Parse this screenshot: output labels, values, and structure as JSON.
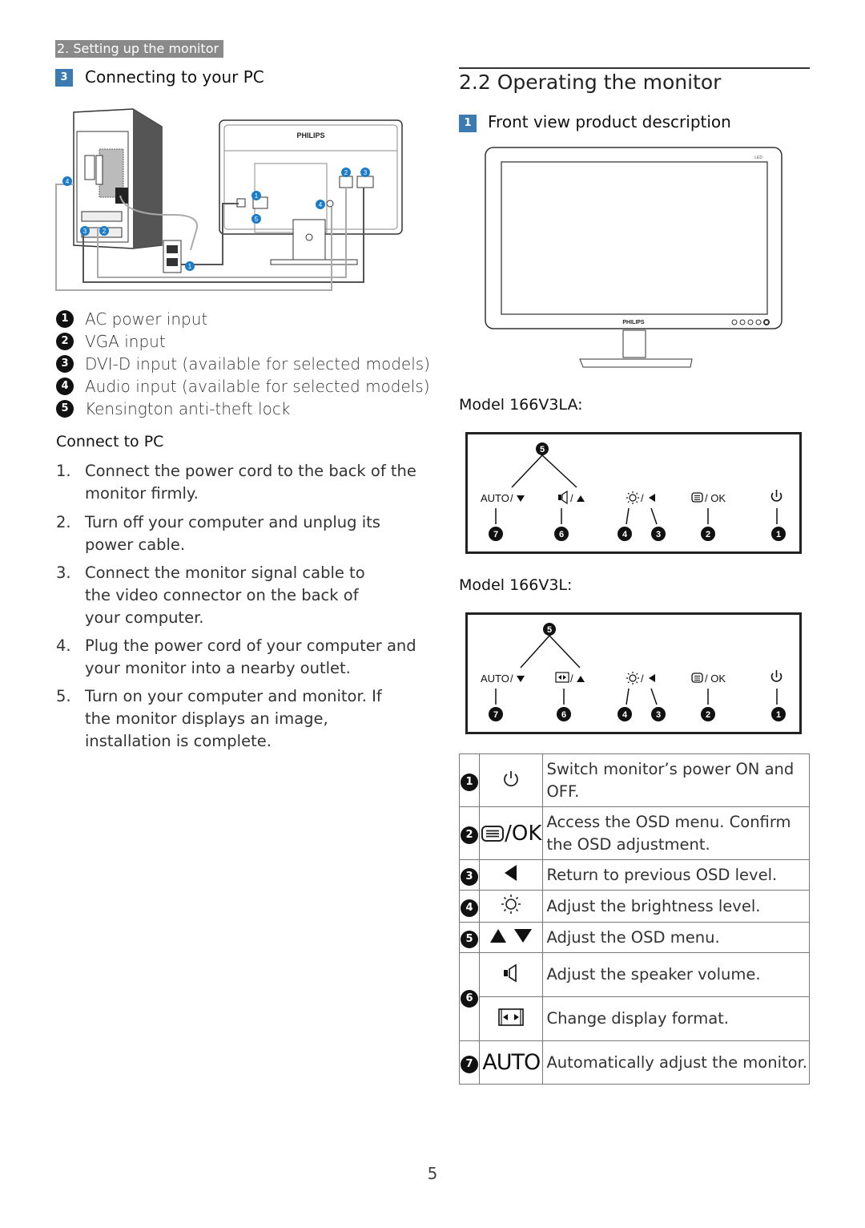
{
  "header": {
    "section_tag": "2. Setting up the monitor",
    "left_heading_num": "3",
    "left_heading": "Connecting to your PC"
  },
  "diagram": {
    "brand": "PHILIPS",
    "callouts": [
      "1",
      "2",
      "3",
      "4",
      "5"
    ]
  },
  "legend": [
    {
      "num": "1",
      "label": "AC power input"
    },
    {
      "num": "2",
      "label": "VGA input"
    },
    {
      "num": "3",
      "label": "DVI-D input (available for selected models)"
    },
    {
      "num": "4",
      "label": "Audio input (available for selected models)"
    },
    {
      "num": "5",
      "label": "Kensington anti-theft lock"
    }
  ],
  "connect": {
    "title": "Connect to PC",
    "steps": [
      {
        "n": "1.",
        "text": "Connect the power cord to the back of the monitor firmly."
      },
      {
        "n": "2.",
        "text": "Turn off your computer and unplug its power cable."
      },
      {
        "n": "3.",
        "text": "Connect the monitor signal cable to the video connector on the back of your computer."
      },
      {
        "n": "4.",
        "text": "Plug the power cord of your computer and your monitor into a nearby outlet."
      },
      {
        "n": "5.",
        "text": "Turn on your computer and monitor. If the monitor displays an image,  installation is complete."
      }
    ]
  },
  "right": {
    "heading": "2.2  Operating the monitor",
    "sub_num": "1",
    "sub_heading": "Front view product description",
    "front_brand": "PHILIPS",
    "front_badge": "LED"
  },
  "models": [
    {
      "label": "Model 166V3LA:",
      "buttons": {
        "auto": "AUTO",
        "ok": "/ OK",
        "second_icon": "speaker-icon"
      },
      "callouts": [
        "5",
        "7",
        "6",
        "4",
        "3",
        "2",
        "1"
      ]
    },
    {
      "label": "Model 166V3L:",
      "buttons": {
        "auto": "AUTO",
        "ok": "/ OK",
        "second_icon": "display-format-icon"
      },
      "callouts": [
        "5",
        "7",
        "6",
        "4",
        "3",
        "2",
        "1"
      ]
    }
  ],
  "key_table": [
    {
      "num": "1",
      "icon": "power-icon",
      "symbol": "",
      "desc": "Switch monitor’s power ON and OFF."
    },
    {
      "num": "2",
      "icon": "menu-ok-icon",
      "symbol": "/OK",
      "desc": "Access the OSD menu. Confirm the OSD adjustment."
    },
    {
      "num": "3",
      "icon": "left-arrow-icon",
      "symbol": "",
      "desc": "Return to previous OSD level."
    },
    {
      "num": "4",
      "icon": "brightness-icon",
      "symbol": "",
      "desc": "Adjust the brightness level."
    },
    {
      "num": "5",
      "icon": "up-down-arrows-icon",
      "symbol": "",
      "desc": "Adjust the OSD menu."
    },
    {
      "num": "6",
      "icon": "speaker-icon",
      "symbol": "",
      "desc": "Adjust the speaker volume."
    },
    {
      "num": "6",
      "icon": "display-format-icon",
      "symbol": "",
      "desc": "Change display format."
    },
    {
      "num": "7",
      "icon": "auto-icon",
      "symbol": "AUTO",
      "desc": "Automatically adjust the monitor."
    }
  ],
  "page_number": "5"
}
